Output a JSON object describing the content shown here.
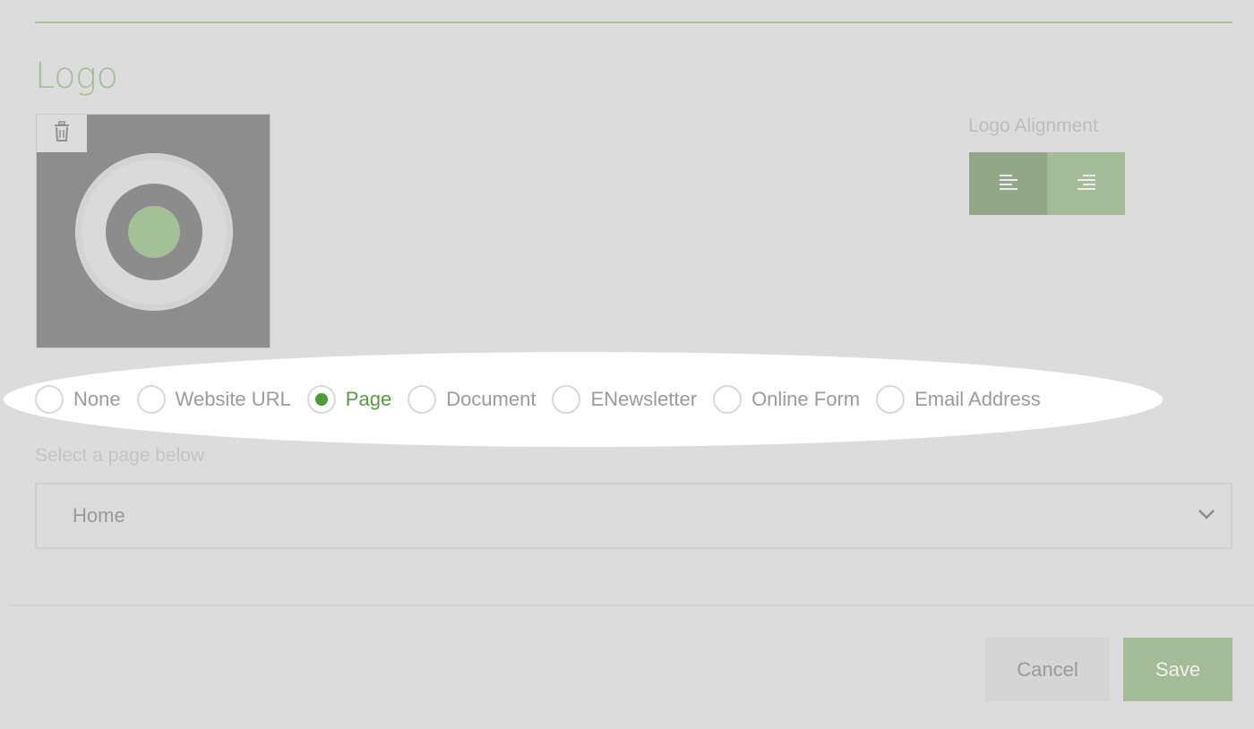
{
  "section": {
    "title": "Logo"
  },
  "logo": {
    "delete_icon": "trash-icon",
    "alignment_label": "Logo Alignment",
    "alignment_options": [
      {
        "icon": "align-left-icon",
        "active": true
      },
      {
        "icon": "align-right-icon",
        "active": false
      }
    ]
  },
  "link_type": {
    "options": [
      {
        "label": "None",
        "selected": false
      },
      {
        "label": "Website URL",
        "selected": false
      },
      {
        "label": "Page",
        "selected": true
      },
      {
        "label": "Document",
        "selected": false
      },
      {
        "label": "ENewsletter",
        "selected": false
      },
      {
        "label": "Online Form",
        "selected": false
      },
      {
        "label": "Email Address",
        "selected": false
      }
    ]
  },
  "page_select": {
    "caption": "Select a page below",
    "value": "Home",
    "icon": "chevron-down-icon"
  },
  "footer": {
    "cancel_label": "Cancel",
    "save_label": "Save"
  },
  "colors": {
    "background": "#dcdcdc",
    "accent": "#a4bb97",
    "accent_dark": "#91a788",
    "selected_radio": "#4e9a3a",
    "highlight": "#ffffff"
  }
}
